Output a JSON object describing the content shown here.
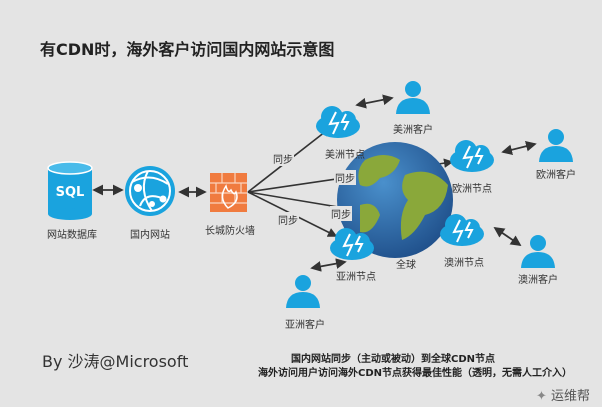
{
  "title": "有CDN时，海外客户访问国内网站示意图",
  "nodes": {
    "database": {
      "label": "网站数据库",
      "icon_text": "SQL"
    },
    "site": {
      "label": "国内网站"
    },
    "firewall": {
      "label": "长城防火墙"
    },
    "globe": {
      "label": "全球"
    },
    "us_node": {
      "label": "美洲节点"
    },
    "us_client": {
      "label": "美洲客户"
    },
    "eu_node": {
      "label": "欧洲节点"
    },
    "eu_client": {
      "label": "欧洲客户"
    },
    "asia_node": {
      "label": "亚洲节点"
    },
    "asia_client": {
      "label": "亚洲客户"
    },
    "au_node": {
      "label": "澳洲节点"
    },
    "au_client": {
      "label": "澳洲客户"
    }
  },
  "edges": {
    "sync_label": "同步"
  },
  "author": "By 沙涛@Microsoft",
  "footer": {
    "line1": "国内网站同步（主动或被动）到全球CDN节点",
    "line2": "海外访问用户访问海外CDN节点获得最佳性能（透明，无需人工介入）"
  },
  "watermark": "运维帮",
  "colors": {
    "accent": "#1aa3de",
    "firewall": "#f07b3f",
    "earth_ocean": "#2f6fae",
    "earth_land": "#8aa83a"
  }
}
